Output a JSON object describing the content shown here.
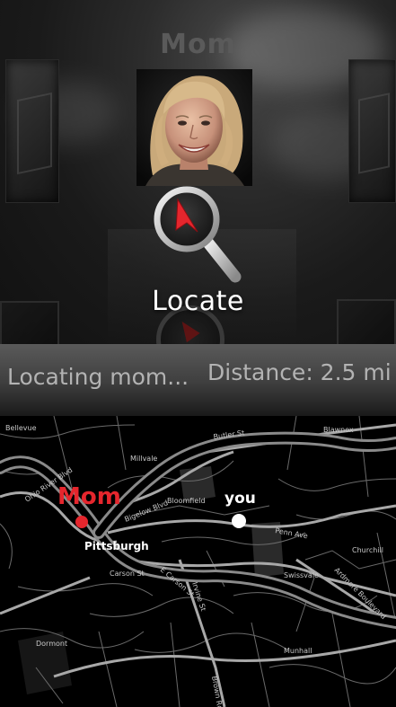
{
  "contact": {
    "name": "Mom"
  },
  "locate_button": {
    "label": "Locate",
    "icon": "locate-magnifier-icon"
  },
  "status": {
    "locating_text": "Locating mom...",
    "distance_text": "Distance: 2.5 mi"
  },
  "map": {
    "mom_label": "Mom",
    "you_label": "you",
    "mom_color": "#e5262d",
    "you_color": "#ffffff",
    "places": {
      "bellevue": "Bellevue",
      "blawnox": "Blawnox",
      "millvale": "Millvale",
      "bloomfield": "Bloomfield",
      "pittsburgh": "Pittsburgh",
      "churchill": "Churchill",
      "swissvale": "Swissvale",
      "dormont": "Dormont",
      "munhall": "Munhall"
    },
    "streets": {
      "butler_st": "Butler St",
      "bigelow_blvd": "Bigelow Blvd",
      "penn_ave": "Penn Ave",
      "carson_st": "Carson St",
      "e_carson_st": "E Carson St",
      "irvine_st": "Irvine St",
      "ardmore_blvd": "Ardmore Boulevard",
      "ohio_river_blvd": "Ohio River Blvd",
      "brown_rd": "Brown Rd"
    }
  },
  "colors": {
    "accent": "#e5262d",
    "status_text": "#b3b3b3",
    "name_text": "#5a5a5a"
  }
}
